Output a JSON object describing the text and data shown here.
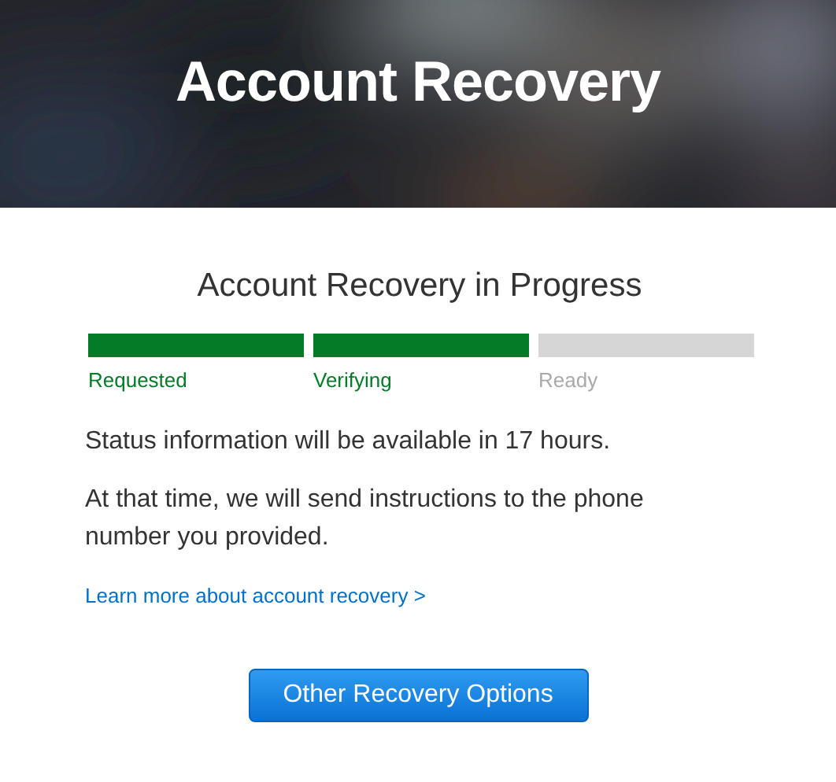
{
  "header": {
    "title": "Account Recovery"
  },
  "heading": "Account Recovery in Progress",
  "steps": [
    {
      "label": "Requested",
      "done": true
    },
    {
      "label": "Verifying",
      "done": true
    },
    {
      "label": "Ready",
      "done": false
    }
  ],
  "paragraphs": [
    "Status information will be available in 17 hours.",
    "At that time, we will send instructions to the phone number you provided."
  ],
  "link": "Learn more about account recovery >",
  "button": "Other Recovery Options"
}
